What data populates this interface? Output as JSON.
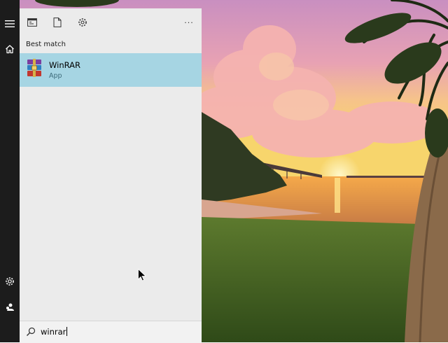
{
  "start_menu": {
    "rail": {
      "buttons": [
        "menu",
        "home",
        "settings",
        "account"
      ]
    },
    "toolbar": {
      "buttons": [
        "apps-filter",
        "documents-filter",
        "settings-filter",
        "more"
      ],
      "more_label": "···"
    },
    "section_title": "Best match",
    "best_match": {
      "name": "WinRAR",
      "type": "App",
      "icon": "winrar-app-icon"
    },
    "search": {
      "value": "winrar",
      "icon": "search-icon"
    }
  },
  "colors": {
    "rail_bg": "#1c1c1c",
    "panel_bg": "#ebebeb",
    "selected_bg": "#a6d5e3"
  }
}
